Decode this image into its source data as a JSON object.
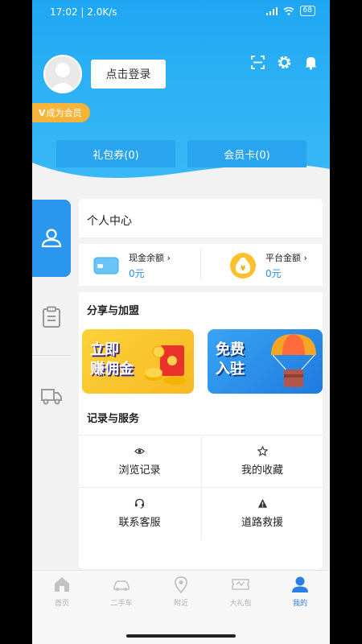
{
  "status_bar": {
    "time": "17:02 | 2.0K/s",
    "battery": "68"
  },
  "header": {
    "login_label": "点击登录",
    "vip_label": "成为会员",
    "vip_letter": "V",
    "gift_card_label": "礼包券(0)",
    "member_card_label": "会员卡(0)",
    "icons": [
      "scan-icon",
      "gear-icon",
      "bell-icon"
    ]
  },
  "side_tabs": [
    "person-icon",
    "clipboard-icon",
    "truck-icon"
  ],
  "personal_center": {
    "title": "个人中心",
    "cash_label": "现金余额",
    "cash_value": "0元",
    "platform_label": "平台金额",
    "platform_value": "0元"
  },
  "share": {
    "title": "分享与加盟",
    "banner1_line1": "立即",
    "banner1_line2": "赚佣金",
    "banner2_line1": "免费",
    "banner2_line2": "入驻"
  },
  "services": {
    "title": "记录与服务",
    "items": [
      {
        "label": "浏览记录",
        "icon": "eye-icon"
      },
      {
        "label": "我的收藏",
        "icon": "star-icon"
      },
      {
        "label": "联系客服",
        "icon": "headset-icon"
      },
      {
        "label": "道路救援",
        "icon": "warning-icon"
      }
    ]
  },
  "bottom_nav": {
    "items": [
      {
        "label": "首页",
        "icon": "home-icon"
      },
      {
        "label": "二手车",
        "icon": "car-icon"
      },
      {
        "label": "附近",
        "icon": "location-icon"
      },
      {
        "label": "大礼包",
        "icon": "ticket-icon"
      },
      {
        "label": "我的",
        "icon": "user-icon"
      }
    ],
    "active_index": 4
  },
  "colors": {
    "primary": "#2a96ee",
    "vip": "#f6b43a",
    "active_nav": "#2a7fe6"
  }
}
